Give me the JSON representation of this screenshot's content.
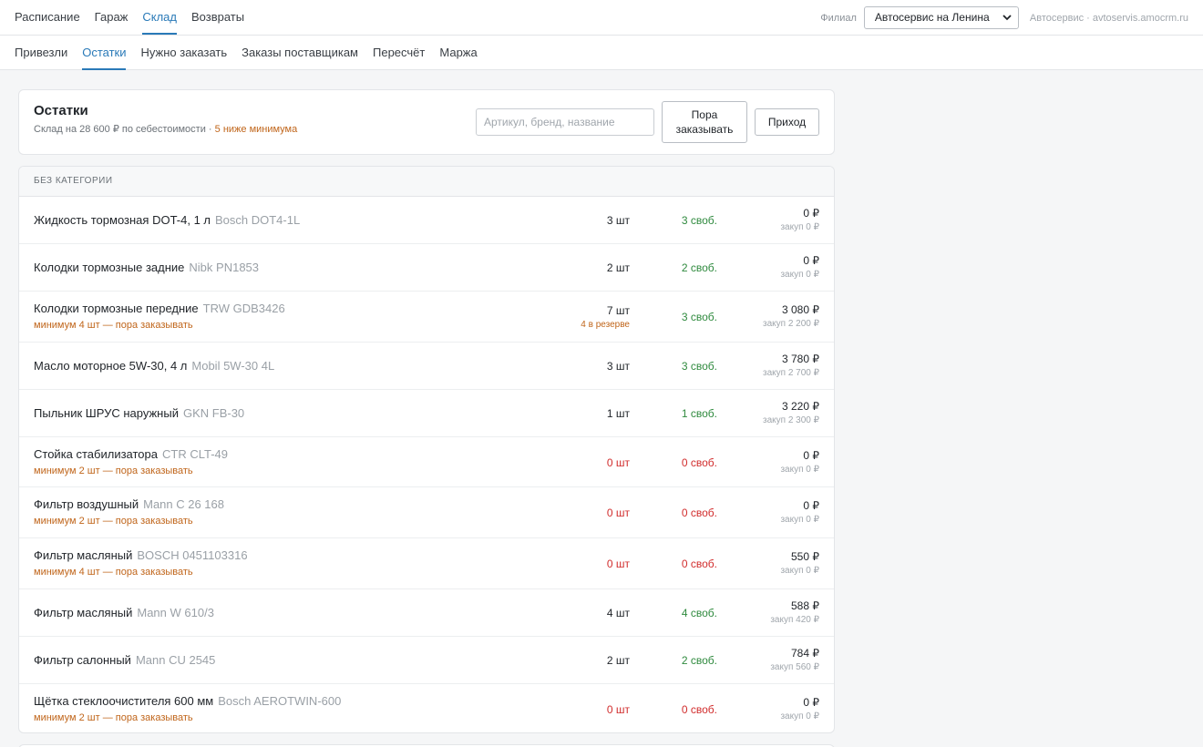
{
  "top_nav": [
    {
      "label": "Расписание",
      "active": false
    },
    {
      "label": "Гараж",
      "active": false
    },
    {
      "label": "Склад",
      "active": true
    },
    {
      "label": "Возвраты",
      "active": false
    }
  ],
  "branch": {
    "label": "Филиал",
    "selected": "Автосервис на Ленина",
    "org": "Автосервис · avtoservis.amocrm.ru"
  },
  "sub_nav": [
    {
      "label": "Привезли",
      "active": false
    },
    {
      "label": "Остатки",
      "active": true
    },
    {
      "label": "Нужно заказать",
      "active": false
    },
    {
      "label": "Заказы поставщикам",
      "active": false
    },
    {
      "label": "Пересчёт",
      "active": false
    },
    {
      "label": "Маржа",
      "active": false
    }
  ],
  "header": {
    "title": "Остатки",
    "subtitle_text": "Склад на 28 600 ₽ по себестоимости · ",
    "subtitle_warning": "5 ниже минимума",
    "search_placeholder": "Артикул, бренд, название",
    "order_button_line1": "Пора",
    "order_button_line2": "заказывать",
    "income_button": "Приход"
  },
  "category": "БЕЗ КАТЕГОРИИ",
  "items": [
    {
      "name": "Жидкость тормозная DOT-4, 1 л",
      "article": "Bosch DOT4-1L",
      "min_note": "",
      "qty": "3 шт",
      "reserve": "",
      "free": "3 своб.",
      "price": "0 ₽",
      "cost": "закуп 0 ₽",
      "zero": false
    },
    {
      "name": "Колодки тормозные задние",
      "article": "Nibk PN1853",
      "min_note": "",
      "qty": "2 шт",
      "reserve": "",
      "free": "2 своб.",
      "price": "0 ₽",
      "cost": "закуп 0 ₽",
      "zero": false
    },
    {
      "name": "Колодки тормозные передние",
      "article": "TRW GDB3426",
      "min_note": "минимум 4 шт — пора заказывать",
      "qty": "7 шт",
      "reserve": "4 в резерве",
      "free": "3 своб.",
      "price": "3 080 ₽",
      "cost": "закуп 2 200 ₽",
      "zero": false
    },
    {
      "name": "Масло моторное 5W-30, 4 л",
      "article": "Mobil 5W-30 4L",
      "min_note": "",
      "qty": "3 шт",
      "reserve": "",
      "free": "3 своб.",
      "price": "3 780 ₽",
      "cost": "закуп 2 700 ₽",
      "zero": false
    },
    {
      "name": "Пыльник ШРУС наружный",
      "article": "GKN FB-30",
      "min_note": "",
      "qty": "1 шт",
      "reserve": "",
      "free": "1 своб.",
      "price": "3 220 ₽",
      "cost": "закуп 2 300 ₽",
      "zero": false
    },
    {
      "name": "Стойка стабилизатора",
      "article": "CTR CLT-49",
      "min_note": "минимум 2 шт — пора заказывать",
      "qty": "0 шт",
      "reserve": "",
      "free": "0 своб.",
      "price": "0 ₽",
      "cost": "закуп 0 ₽",
      "zero": true
    },
    {
      "name": "Фильтр воздушный",
      "article": "Mann C 26 168",
      "min_note": "минимум 2 шт — пора заказывать",
      "qty": "0 шт",
      "reserve": "",
      "free": "0 своб.",
      "price": "0 ₽",
      "cost": "закуп 0 ₽",
      "zero": true
    },
    {
      "name": "Фильтр масляный",
      "article": "BOSCH 0451103316",
      "min_note": "минимум 4 шт — пора заказывать",
      "qty": "0 шт",
      "reserve": "",
      "free": "0 своб.",
      "price": "550 ₽",
      "cost": "закуп 0 ₽",
      "zero": true
    },
    {
      "name": "Фильтр масляный",
      "article": "Mann W 610/3",
      "min_note": "",
      "qty": "4 шт",
      "reserve": "",
      "free": "4 своб.",
      "price": "588 ₽",
      "cost": "закуп 420 ₽",
      "zero": false
    },
    {
      "name": "Фильтр салонный",
      "article": "Mann CU 2545",
      "min_note": "",
      "qty": "2 шт",
      "reserve": "",
      "free": "2 своб.",
      "price": "784 ₽",
      "cost": "закуп 560 ₽",
      "zero": false
    },
    {
      "name": "Щётка стеклоочистителя 600 мм",
      "article": "Bosch AEROTWIN-600",
      "min_note": "минимум 2 шт — пора заказывать",
      "qty": "0 шт",
      "reserve": "",
      "free": "0 своб.",
      "price": "0 ₽",
      "cost": "закуп 0 ₽",
      "zero": true
    }
  ],
  "colors": {
    "accent": "#2a7ab8",
    "warning": "#c0651a",
    "free_ok": "#2f8a3e",
    "zero": "#d12d2d"
  },
  "icons": {
    "branch_select": "chevron-down-icon"
  }
}
